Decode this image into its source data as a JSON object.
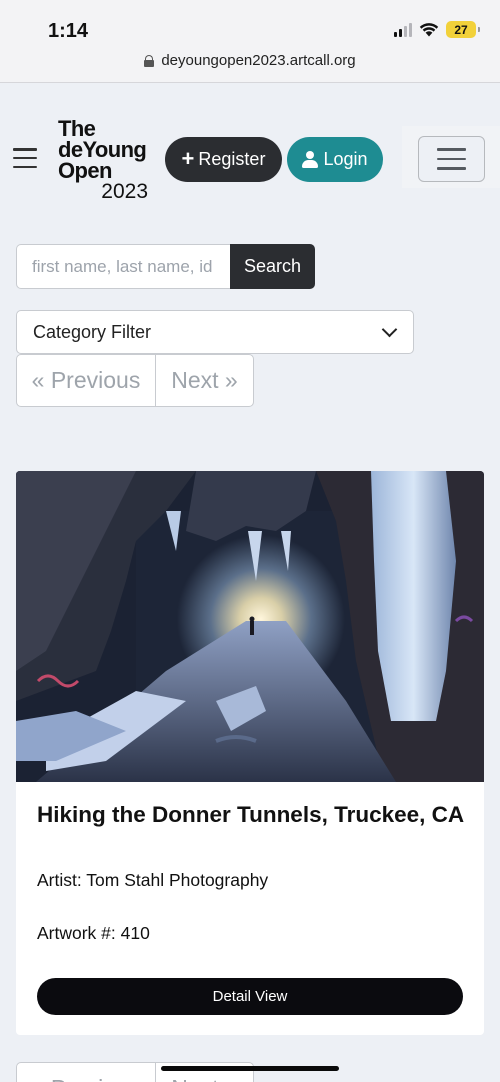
{
  "status_bar": {
    "time": "1:14",
    "battery": "27"
  },
  "browser": {
    "url": "deyoungopen2023.artcall.org"
  },
  "header": {
    "logo_lines": [
      "The",
      "deYoung",
      "Open"
    ],
    "logo_year": "2023",
    "register_label": "Register",
    "login_label": "Login"
  },
  "search": {
    "placeholder": "first name, last name, id",
    "value": "",
    "button_label": "Search"
  },
  "filter": {
    "selected": "Category Filter"
  },
  "pagination": {
    "previous_label": "« Previous",
    "next_label": "Next »"
  },
  "artwork": {
    "title": "Hiking the Donner Tunnels, Truckee, CA",
    "artist_line": "Artist: Tom Stahl Photography",
    "number_line": "Artwork #: 410",
    "detail_label": "Detail View"
  },
  "colors": {
    "page_bg": "#edf0f5",
    "dark_button": "#2b2d31",
    "login_teal": "#1e8c92",
    "battery_yellow": "#f2d13a"
  }
}
